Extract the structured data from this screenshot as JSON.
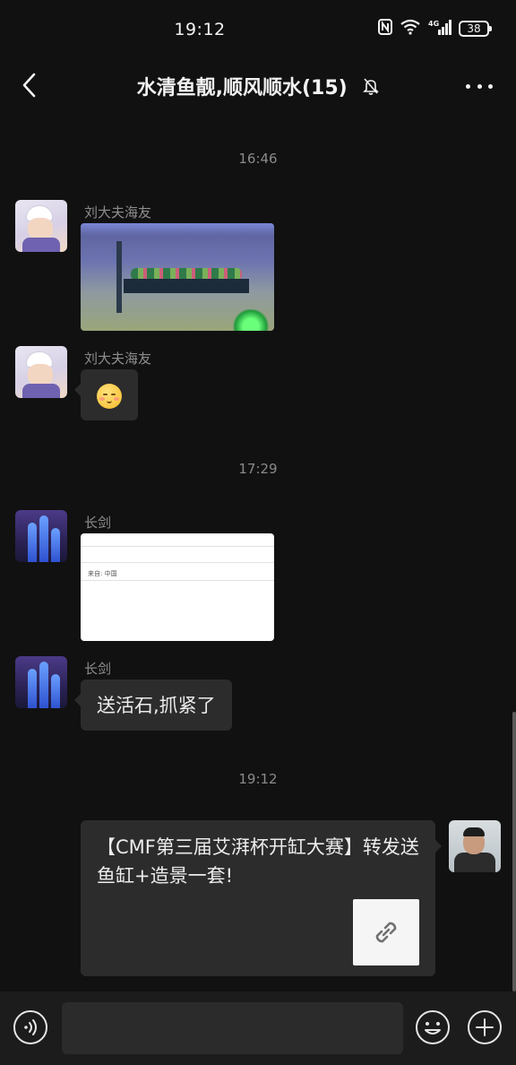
{
  "status_bar": {
    "time": "19:12",
    "icons": [
      "nfc-icon",
      "wifi-icon",
      "signal-4g-icon"
    ],
    "signal_label": "4G",
    "battery": "38"
  },
  "header": {
    "title": "水清鱼靓,顺风顺水(15)",
    "icons": [
      "back-icon",
      "mute-bell-icon",
      "more-icon"
    ]
  },
  "messages": [
    {
      "type": "timestamp",
      "text": "16:46"
    },
    {
      "type": "image",
      "sender": "刘大夫海友",
      "side": "left",
      "image": "aquarium-photo"
    },
    {
      "type": "sticker",
      "sender": "刘大夫海友",
      "side": "left",
      "sticker": "blushing-smile-emoji"
    },
    {
      "type": "timestamp",
      "text": "17:29"
    },
    {
      "type": "image",
      "sender": "长剑",
      "side": "left",
      "image": "document-screenshot",
      "image_text": "来自: 中国"
    },
    {
      "type": "text",
      "sender": "长剑",
      "side": "left",
      "text": "送活石,抓紧了"
    },
    {
      "type": "timestamp",
      "text": "19:12"
    },
    {
      "type": "link",
      "side": "right",
      "text": "【CMF第三届艾湃杯开缸大赛】转发送鱼缸+造景一套!",
      "thumb_icon": "link-icon"
    }
  ],
  "input_bar": {
    "value": "",
    "icons": [
      "voice-icon",
      "emoji-icon",
      "plus-icon"
    ]
  },
  "colors": {
    "background": "#111111",
    "bubble": "#2c2c2c",
    "input_bar": "#1c1c1c",
    "meta_text": "#8a8a8a"
  }
}
